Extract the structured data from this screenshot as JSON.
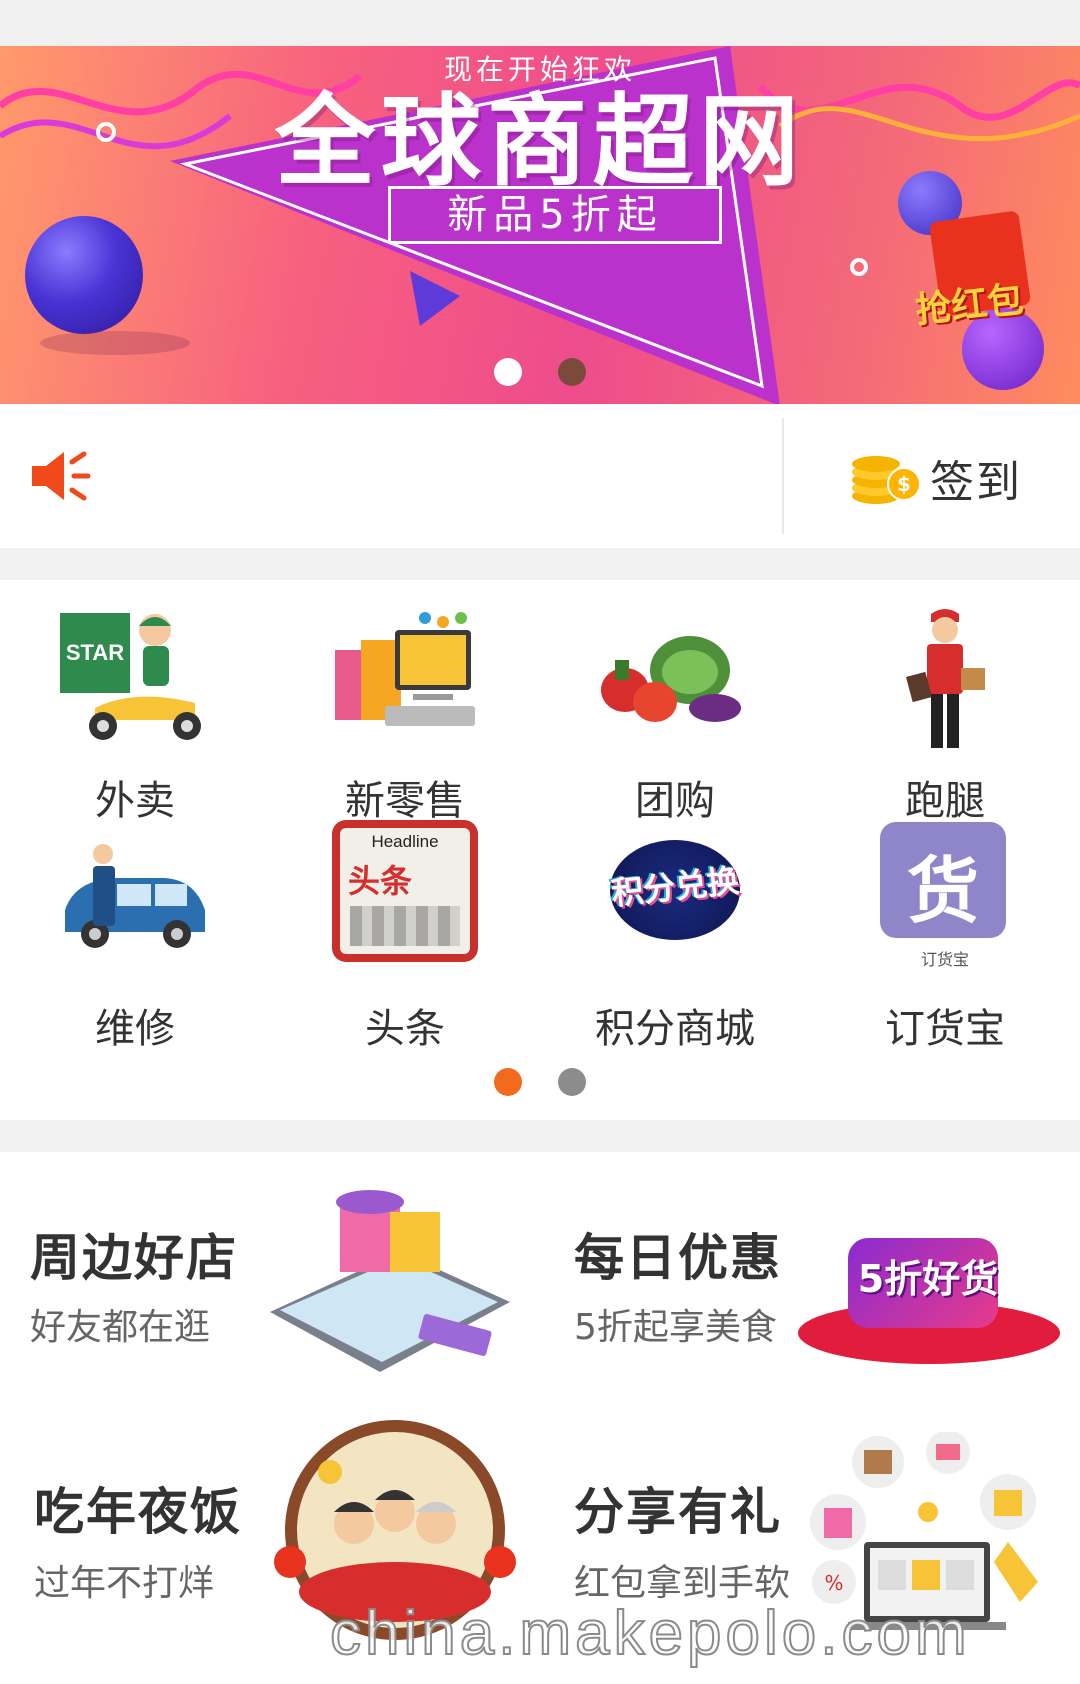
{
  "banner": {
    "subtitle": "现在开始狂欢",
    "title": "全球商超网",
    "tagline": "新品5折起",
    "redpack_text": "抢红包",
    "dots": 2,
    "active_dot": 0
  },
  "notice": {
    "speaker_icon": "speaker-icon",
    "signin_icon": "coins-icon",
    "signin_label": "签到"
  },
  "grid": {
    "items": [
      {
        "label": "外卖",
        "icon": "delivery-scooter-icon"
      },
      {
        "label": "新零售",
        "icon": "retail-computer-icon"
      },
      {
        "label": "团购",
        "icon": "vegetables-icon"
      },
      {
        "label": "跑腿",
        "icon": "courier-icon"
      },
      {
        "label": "维修",
        "icon": "repair-car-icon"
      },
      {
        "label": "头条",
        "icon": "headline-newspaper-icon",
        "icon_text_top": "Headline",
        "icon_text_main": "头条"
      },
      {
        "label": "积分商城",
        "icon": "points-exchange-icon",
        "icon_text": "积分兑换"
      },
      {
        "label": "订货宝",
        "icon": "order-goods-icon",
        "icon_text": "货",
        "icon_caption": "订货宝"
      }
    ],
    "active_page": 0
  },
  "promos": [
    {
      "title": "周边好店",
      "subtitle": "好友都在逛",
      "image": "phone-shop-illustration"
    },
    {
      "title": "每日优惠",
      "subtitle": "5折起享美食",
      "image": "discount-badge",
      "image_text": "5折好货"
    },
    {
      "title": "吃年夜饭",
      "subtitle": "过年不打烊",
      "image": "new-year-dinner-illustration"
    },
    {
      "title": "分享有礼",
      "subtitle": "红包拿到手软",
      "image": "share-gifts-illustration"
    }
  ],
  "watermark": "china.makepolo.com",
  "colors": {
    "accent_orange": "#f26b1d",
    "banner_pink": "#ee4c8c",
    "banner_purple": "#b62fd0",
    "coin_gold": "#f5b400",
    "speaker_red": "#f04a1b"
  }
}
